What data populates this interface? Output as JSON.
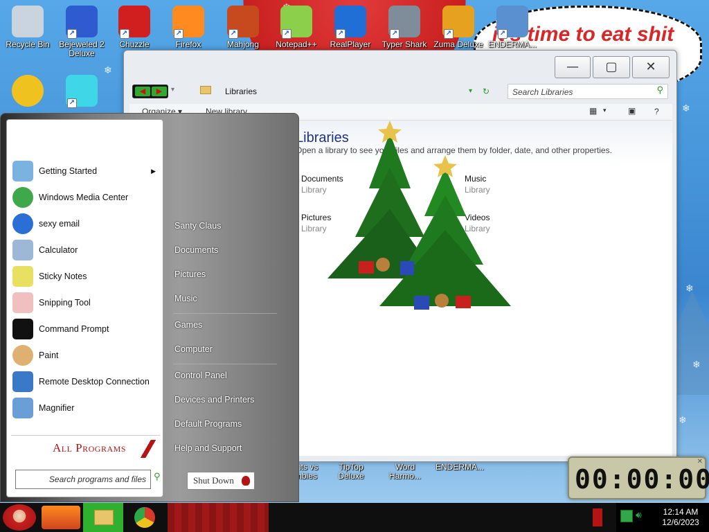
{
  "desktop": {
    "bubble_text": "it's time to eat shit",
    "icons": [
      {
        "label": "Recycle Bin",
        "color": "#c9d4de"
      },
      {
        "label": "Bejeweled 2 Deluxe",
        "color": "#2f5bd0"
      },
      {
        "label": "Chuzzle",
        "color": "#d11f1f"
      },
      {
        "label": "Firefox",
        "color": "#ff8a1f"
      },
      {
        "label": "Mahjong",
        "color": "#c74a1f"
      },
      {
        "label": "Notepad++",
        "color": "#8ccf4a"
      },
      {
        "label": "RealPlayer",
        "color": "#1f6fd6"
      },
      {
        "label": "Typer Shark",
        "color": "#7f8c99"
      },
      {
        "label": "Zuma Deluxe",
        "color": "#e6a21f"
      },
      {
        "label": "ENDERMA...",
        "color": "#5a8fd0"
      },
      {
        "label": "",
        "color": "#f0c21f"
      },
      {
        "label": "",
        "color": "#3fd6e8"
      }
    ],
    "bottom_icons": [
      "Plants vs Zombies",
      "TipTop Deluxe",
      "Word Harmo...",
      "ENDERMA..."
    ]
  },
  "explorer": {
    "address": "Libraries",
    "search_placeholder": "Search Libraries",
    "toolbar": {
      "organize": "Organize ▾",
      "new_library": "New library",
      "help": "?"
    },
    "header_title": "Libraries",
    "header_subtitle": "Open a library to see your files and arrange them by folder, date, and other properties.",
    "libraries": [
      {
        "name": "Documents",
        "type": "Library"
      },
      {
        "name": "Music",
        "type": "Library"
      },
      {
        "name": "Pictures",
        "type": "Library"
      },
      {
        "name": "Videos",
        "type": "Library"
      }
    ],
    "caption": {
      "minimize": "—",
      "maximize": "▢",
      "close": "✕"
    }
  },
  "start_menu": {
    "pinned": [
      {
        "label": "Getting Started",
        "icon": "getting-started-icon",
        "color": "#7bb3e0",
        "submenu": true
      },
      {
        "label": "Windows Media Center",
        "icon": "media-center-icon",
        "color": "#3fa84a"
      },
      {
        "label": "sexy email",
        "icon": "email-icon",
        "color": "#2a6ed6"
      },
      {
        "label": "Calculator",
        "icon": "calculator-icon",
        "color": "#9cb8d6"
      },
      {
        "label": "Sticky Notes",
        "icon": "sticky-notes-icon",
        "color": "#e8e060"
      },
      {
        "label": "Snipping Tool",
        "icon": "scissors-icon",
        "color": "#d84a4a"
      },
      {
        "label": "Command Prompt",
        "icon": "terminal-icon",
        "color": "#111111"
      },
      {
        "label": "Paint",
        "icon": "palette-icon",
        "color": "#e0b070"
      },
      {
        "label": "Remote Desktop Connection",
        "icon": "remote-desktop-icon",
        "color": "#3a78c8"
      },
      {
        "label": "Magnifier",
        "icon": "magnifier-icon",
        "color": "#6a9ed6"
      }
    ],
    "all_programs": "All Programs",
    "search_placeholder": "Search programs and files",
    "right_links": [
      "Santy Claus",
      "Documents",
      "Pictures",
      "Music",
      "Games",
      "Computer",
      "Control Panel",
      "Devices and Printers",
      "Default Programs",
      "Help and Support"
    ],
    "shutdown": "Shut Down"
  },
  "taskbar": {
    "time": "12:14 AM",
    "date": "12/6/2023"
  },
  "timer": {
    "value": "00:00:00"
  },
  "colors": {
    "accent_red": "#c81f1f",
    "sky": "#3d8fd6",
    "nav_green": "#2eaa2e"
  }
}
